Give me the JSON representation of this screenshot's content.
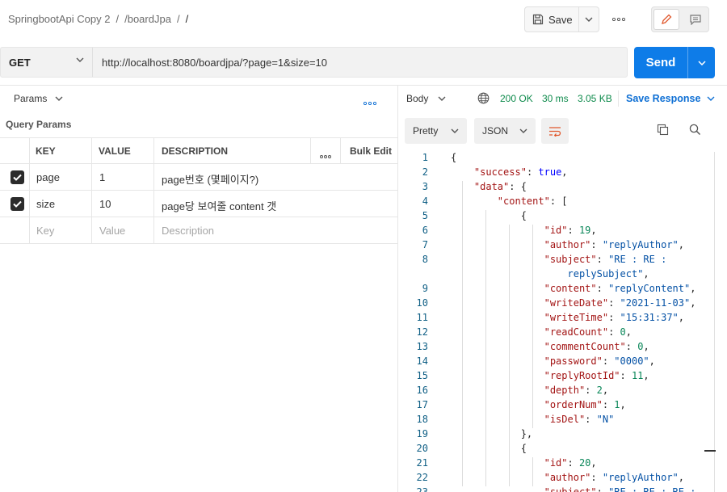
{
  "breadcrumb": {
    "collection": "SpringbootApi Copy 2",
    "folder": "/boardJpa",
    "request": "/"
  },
  "toolbar": {
    "save_label": "Save"
  },
  "request": {
    "method": "GET",
    "url": "http://localhost:8080/boardjpa/?page=1&size=10",
    "send_label": "Send"
  },
  "params": {
    "tab_label": "Params",
    "section_title": "Query Params",
    "headers": {
      "key": "KEY",
      "value": "VALUE",
      "description": "DESCRIPTION",
      "bulk_edit": "Bulk Edit"
    },
    "rows": [
      {
        "checked": true,
        "key": "page",
        "value": "1",
        "description": "page번호 (몇페이지?)"
      },
      {
        "checked": true,
        "key": "size",
        "value": "10",
        "description": "page당 보여줄 content 갯"
      }
    ],
    "placeholder": {
      "key": "Key",
      "value": "Value",
      "description": "Description"
    }
  },
  "response": {
    "tab_label": "Body",
    "status": "200 OK",
    "time": "30 ms",
    "size": "3.05 KB",
    "save_response_label": "Save Response",
    "format_label": "Pretty",
    "type_label": "JSON"
  },
  "code_lines": [
    {
      "n": "1",
      "html": "{"
    },
    {
      "n": "2",
      "html": "    <span class=\"k\">\"success\"</span>: <span class=\"b\">true</span>,"
    },
    {
      "n": "3",
      "html": "    <span class=\"k\">\"data\"</span>: {"
    },
    {
      "n": "4",
      "html": "        <span class=\"k\">\"content\"</span>: ["
    },
    {
      "n": "5",
      "html": "            {"
    },
    {
      "n": "6",
      "html": "                <span class=\"k\">\"id\"</span>: <span class=\"n\">19</span>,"
    },
    {
      "n": "7",
      "html": "                <span class=\"k\">\"author\"</span>: <span class=\"s2\">\"replyAuthor\"</span>,"
    },
    {
      "n": "8",
      "html": "                <span class=\"k\">\"subject\"</span>: <span class=\"s2\">\"RE : RE :</span>"
    },
    {
      "n": "",
      "html": "                    <span class=\"s2\">replySubject\"</span>,"
    },
    {
      "n": "9",
      "html": "                <span class=\"k\">\"content\"</span>: <span class=\"s2\">\"replyContent\"</span>,"
    },
    {
      "n": "10",
      "html": "                <span class=\"k\">\"writeDate\"</span>: <span class=\"s2\">\"2021-11-03\"</span>,"
    },
    {
      "n": "11",
      "html": "                <span class=\"k\">\"writeTime\"</span>: <span class=\"s2\">\"15:31:37\"</span>,"
    },
    {
      "n": "12",
      "html": "                <span class=\"k\">\"readCount\"</span>: <span class=\"n\">0</span>,"
    },
    {
      "n": "13",
      "html": "                <span class=\"k\">\"commentCount\"</span>: <span class=\"n\">0</span>,"
    },
    {
      "n": "14",
      "html": "                <span class=\"k\">\"password\"</span>: <span class=\"s2\">\"0000\"</span>,"
    },
    {
      "n": "15",
      "html": "                <span class=\"k\">\"replyRootId\"</span>: <span class=\"n\">11</span>,"
    },
    {
      "n": "16",
      "html": "                <span class=\"k\">\"depth\"</span>: <span class=\"n\">2</span>,"
    },
    {
      "n": "17",
      "html": "                <span class=\"k\">\"orderNum\"</span>: <span class=\"n\">1</span>,"
    },
    {
      "n": "18",
      "html": "                <span class=\"k\">\"isDel\"</span>: <span class=\"s2\">\"N\"</span>"
    },
    {
      "n": "19",
      "html": "            },"
    },
    {
      "n": "20",
      "html": "            {"
    },
    {
      "n": "21",
      "html": "                <span class=\"k\">\"id\"</span>: <span class=\"n\">20</span>,"
    },
    {
      "n": "22",
      "html": "                <span class=\"k\">\"author\"</span>: <span class=\"s2\">\"replyAuthor\"</span>,"
    },
    {
      "n": "23",
      "html": "                <span class=\"k\">\"subject\"</span>: <span class=\"s2\">\"RE : RE : RE :</span>"
    }
  ]
}
